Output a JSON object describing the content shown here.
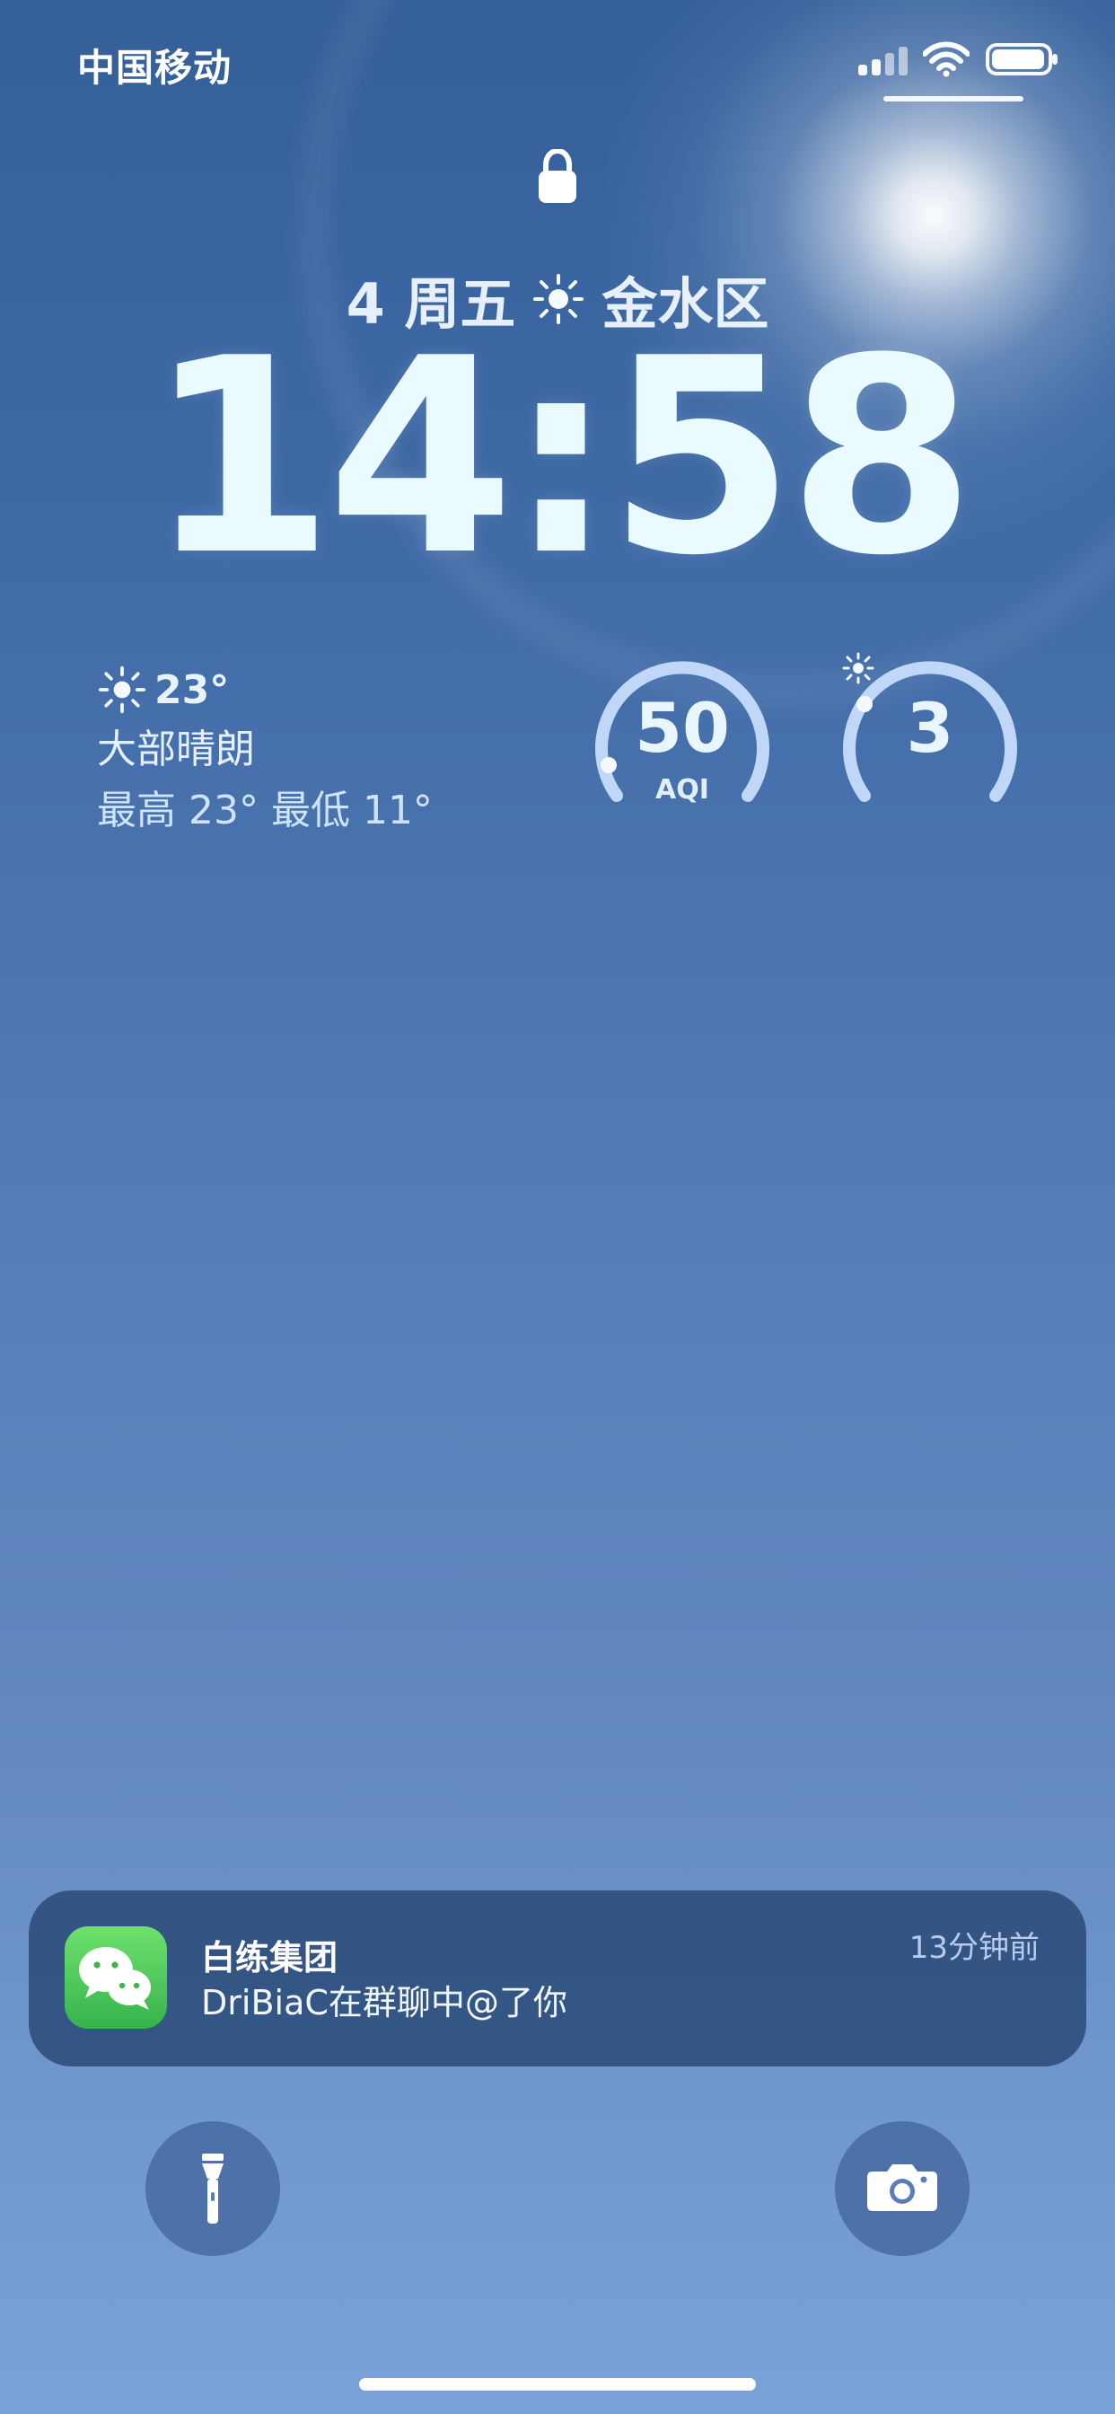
{
  "status_bar": {
    "carrier": "中国移动"
  },
  "lock_screen": {
    "date_text": "4 周五",
    "location": "金水区",
    "time": "14:58"
  },
  "weather": {
    "temperature": "23°",
    "condition": "大部晴朗",
    "range": "最高 23° 最低 11°",
    "aqi": {
      "value": "50",
      "label": "AQI"
    },
    "uv": {
      "value": "3"
    }
  },
  "notification": {
    "app_name": "白练集团",
    "message": "DriBiaC在群聊中@了你",
    "time": "13分钟前"
  },
  "colors": {
    "sky_top": "#355f99",
    "sky_bottom": "#7aa2d9",
    "notification_bg": "#30507e",
    "wechat_green": "#36b34c"
  },
  "icons": {
    "lock": "lock-icon",
    "sun": "sun-icon",
    "flashlight": "flashlight-icon",
    "camera": "camera-icon"
  }
}
